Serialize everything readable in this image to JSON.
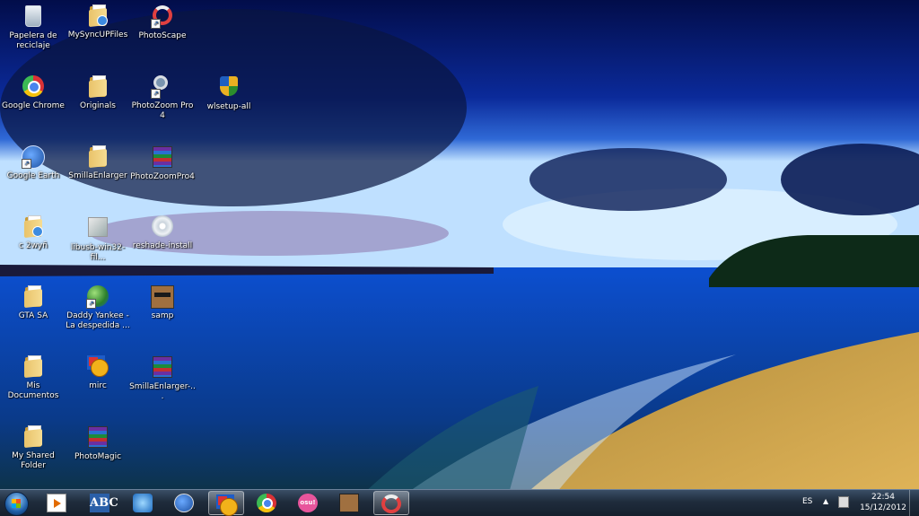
{
  "desktop": {
    "icons": [
      {
        "label": "Papelera de reciclaje",
        "icon": "recycle-bin-icon"
      },
      {
        "label": "MySyncUPFiles",
        "icon": "folder-icon"
      },
      {
        "label": "PhotoScape",
        "icon": "photoscape-icon"
      },
      {
        "label": "Google Chrome",
        "icon": "chrome-icon"
      },
      {
        "label": "Originals",
        "icon": "folder-icon"
      },
      {
        "label": "PhotoZoom Pro 4",
        "icon": "photozoom-icon"
      },
      {
        "label": "wlsetup-all",
        "icon": "windows-live-setup-icon"
      },
      {
        "label": "Google Earth",
        "icon": "google-earth-icon"
      },
      {
        "label": "SmillaEnlarger",
        "icon": "folder-icon"
      },
      {
        "label": "PhotoZoomPro4",
        "icon": "winrar-archive-icon"
      },
      {
        "label": "c 2wyñ",
        "icon": "folder-icon"
      },
      {
        "label": "libusb-win32-fil...",
        "icon": "setup-program-icon"
      },
      {
        "label": "reshade-install",
        "icon": "installer-disc-icon"
      },
      {
        "label": "GTA SA",
        "icon": "folder-icon"
      },
      {
        "label": "Daddy Yankee - La despedida ...",
        "icon": "media-globe-icon"
      },
      {
        "label": "samp",
        "icon": "samp-icon"
      },
      {
        "label": "Mis Documentos",
        "icon": "folder-icon"
      },
      {
        "label": "mirc",
        "icon": "mirc-icon"
      },
      {
        "label": "SmillaEnlarger-...",
        "icon": "winrar-archive-icon"
      },
      {
        "label": "My Shared Folder",
        "icon": "folder-icon"
      },
      {
        "label": "PhotoMagic",
        "icon": "winrar-archive-icon"
      }
    ]
  },
  "taskbar": {
    "start": {
      "icon": "windows-start-orb-icon"
    },
    "pinned": [
      {
        "icon": "media-player-icon",
        "active": false
      },
      {
        "icon": "abc-app-icon",
        "label": "ABC",
        "active": false
      },
      {
        "icon": "extension-app-icon",
        "active": false
      },
      {
        "icon": "google-earth-icon",
        "active": false
      },
      {
        "icon": "mirc-icon",
        "active": true
      },
      {
        "icon": "chrome-icon",
        "active": false
      },
      {
        "icon": "osu-icon",
        "label": "osu!",
        "active": false
      },
      {
        "icon": "samp-icon",
        "active": false
      },
      {
        "icon": "photoscape-icon",
        "active": true
      }
    ],
    "tray": {
      "language": "ES",
      "show_hidden": "▲",
      "time": "22:54",
      "date": "15/12/2012"
    }
  }
}
